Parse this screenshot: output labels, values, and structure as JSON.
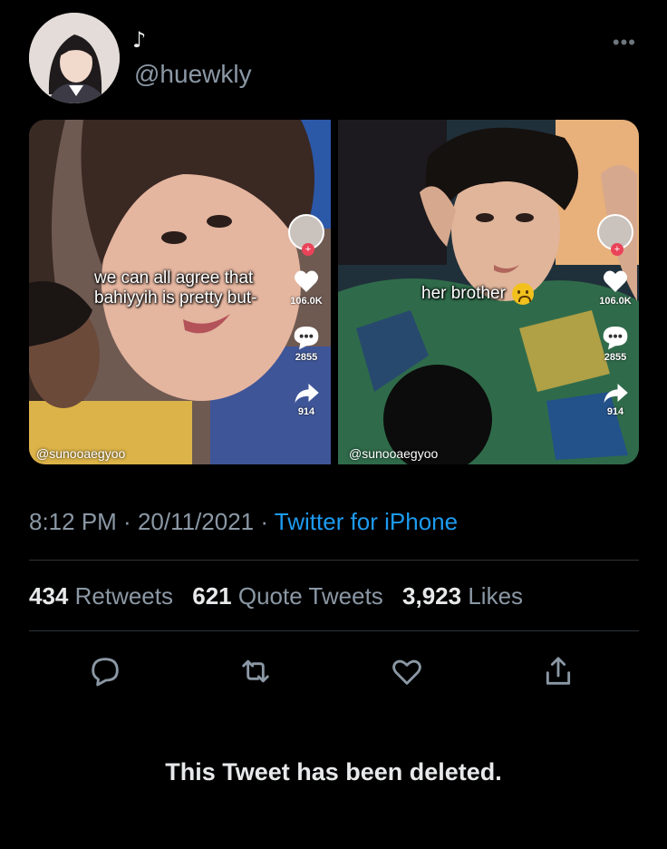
{
  "tweet": {
    "display_name": "♪",
    "handle": "@huewkly",
    "more_icon": "more-horizontal-icon"
  },
  "media": {
    "left": {
      "caption": "we can all agree that bahiyyih is pretty but-",
      "watermark": "@sunooaegyoo",
      "likes": "106.0K",
      "comments": "2855",
      "shares": "914"
    },
    "right": {
      "caption": "her brother",
      "caption_emoji": "weary-face-emoji",
      "watermark": "@sunooaegyoo",
      "likes": "106.0K",
      "comments": "2855",
      "shares": "914"
    }
  },
  "meta": {
    "time": "8:12 PM",
    "separator": " · ",
    "date": "20/11/2021",
    "client": "Twitter for iPhone"
  },
  "stats": {
    "retweets_count": "434",
    "retweets_label": " Retweets",
    "quotes_count": "621",
    "quotes_label": " Quote Tweets",
    "likes_count": "3,923",
    "likes_label": " Likes"
  },
  "actions": [
    "reply-icon",
    "retweet-icon",
    "like-icon",
    "share-icon"
  ],
  "colors": {
    "background": "#000000",
    "link": "#1d9bf0",
    "muted": "#8b98a5",
    "text": "#e7e9ea"
  },
  "notice": "This Tweet has been deleted."
}
